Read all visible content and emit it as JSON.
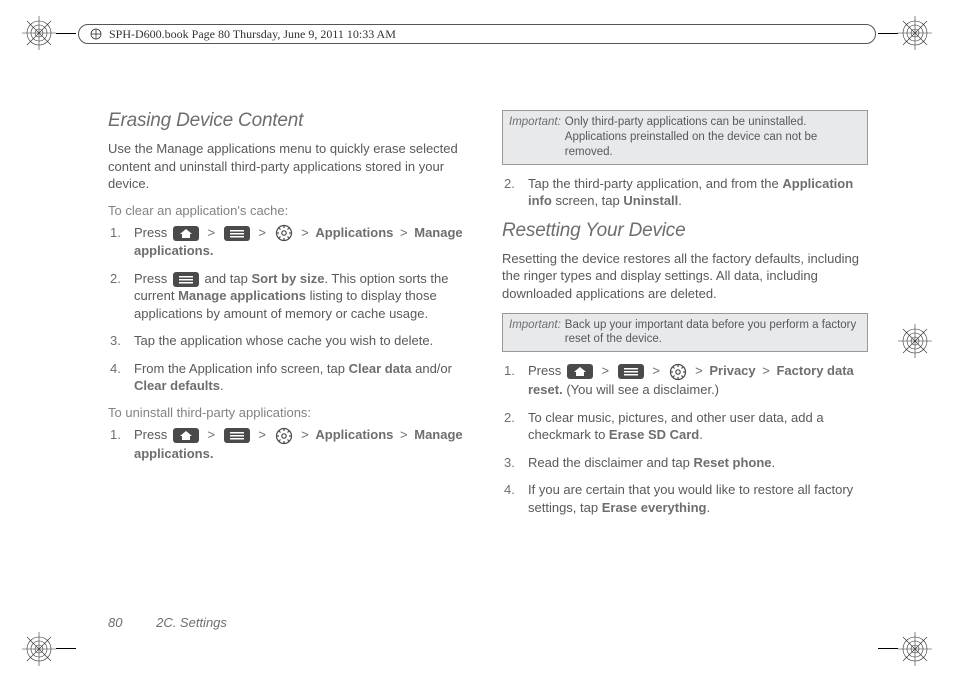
{
  "header_tag": "SPH-D600.book  Page 80  Thursday, June 9, 2011  10:33 AM",
  "left": {
    "h1": "Erasing Device Content",
    "intro": "Use the Manage applications menu to quickly erase selected content and uninstall third-party applications stored in your device.",
    "sub1": "To clear an application's cache:",
    "steps1": {
      "s1a": "Press ",
      "s1b": "Applications",
      "s1c": "Manage applications.",
      "s2a": "Press ",
      "s2b": " and tap ",
      "s2c": "Sort by size",
      "s2d": ". This option sorts the current ",
      "s2e": "Manage applications",
      "s2f": " listing to display those applications by amount of memory or cache usage.",
      "s3": "Tap the application whose cache you wish to delete.",
      "s4a": "From the Application info screen, tap ",
      "s4b": "Clear data",
      "s4c": " and/or ",
      "s4d": "Clear defaults",
      "s4e": "."
    },
    "sub2": "To uninstall third-party applications:",
    "steps2": {
      "s1a": "Press ",
      "s1b": "Applications",
      "s1c": "Manage applications."
    }
  },
  "right": {
    "note1_label": "Important:",
    "note1_text": "Only third-party applications can be uninstalled. Applications preinstalled on the device can not be removed.",
    "step2a": "Tap the third-party application, and from the ",
    "step2b": "Application info",
    "step2c": " screen, tap ",
    "step2d": "Uninstall",
    "step2e": ".",
    "h2": "Resetting Your Device",
    "intro2": "Resetting the device restores all the factory defaults, including the ringer types and display settings. All data, including downloaded applications are deleted.",
    "note2_label": "Important:",
    "note2_text": "Back up your important data before you perform a factory reset of the device.",
    "steps3": {
      "s1a": "Press ",
      "s1b": "Privacy",
      "s1c": "Factory data reset.",
      "s1d": " (You will see a disclaimer.)",
      "s2a": "To clear music, pictures, and other user data, add a checkmark to ",
      "s2b": "Erase SD Card",
      "s2c": ".",
      "s3a": "Read the disclaimer and tap ",
      "s3b": "Reset phone",
      "s3c": ".",
      "s4a": "If you are certain that you would like to restore all factory settings, tap ",
      "s4b": "Erase everything",
      "s4c": "."
    }
  },
  "footer": {
    "page": "80",
    "section": "2C. Settings"
  },
  "sep": ">"
}
